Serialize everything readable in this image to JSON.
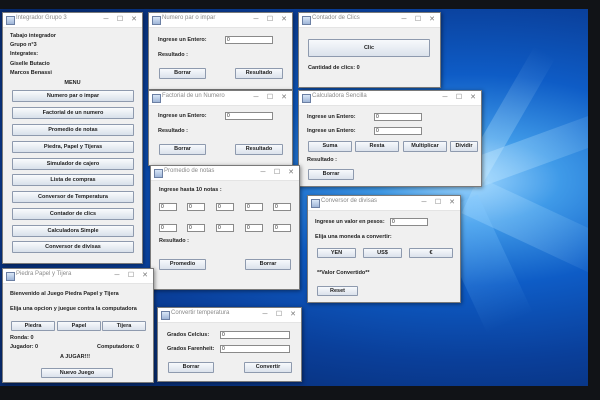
{
  "desktop": {
    "accent": "#0e5cc6"
  },
  "windows": {
    "grupo3": {
      "title": "Integrador Grupo 3",
      "info": [
        "Tabajo integrador",
        "Grupo n°3",
        "Integrates:",
        "Giselle Butacio",
        "Marcos Benassi"
      ],
      "menu_label": "MENU",
      "menu_items": [
        "Numero par o impar",
        "Factorial de un numero",
        "Promedio de notas",
        "Piedra, Papel y Tijeras",
        "Simulador de cajero",
        "Lista de compras",
        "Conversor de Temperatura",
        "Contador de clics",
        "Calculadora Simple",
        "Conversor de divisas"
      ]
    },
    "parimpar": {
      "title": "Numero par o impar",
      "prompt": "Ingrese un Entero:",
      "value": "0",
      "result_label": "Resultado :",
      "clear_label": "Borrar",
      "result_button": "Resultado"
    },
    "clics": {
      "title": "Contador de Clics",
      "button": "Clic",
      "count_label": "Cantidad de clics: 0"
    },
    "factorial": {
      "title": "Factorial de un Numero",
      "prompt": "Ingrese un Entero:",
      "value": "0",
      "result_label": "Resultado :",
      "clear_label": "Borrar",
      "result_button": "Resultado"
    },
    "calc": {
      "title": "Calculadora Sencilla",
      "prompt1": "Ingrese un Entero:",
      "value1": "0",
      "prompt2": "Ingrese un Entero:",
      "value2": "0",
      "ops": [
        "Suma",
        "Resta",
        "Multiplicar",
        "Dividir"
      ],
      "result_label": "Resultado :",
      "clear_label": "Borrar"
    },
    "promedio": {
      "title": "Promedio de notas",
      "prompt": "Ingrese hasta 10 notas :",
      "grades": [
        "0",
        "0",
        "0",
        "0",
        "0",
        "0",
        "0",
        "0",
        "0",
        "0"
      ],
      "result_label": "Resultado :",
      "avg_button": "Promedio",
      "clear_label": "Borrar"
    },
    "divisas": {
      "title": "Conversor de divisas",
      "prompt": "Ingrese un valor en pesos:",
      "value": "0",
      "choose_label": "Elija una moneda a convertir:",
      "currencies": [
        "YEN",
        "US$",
        "€"
      ],
      "converted_label": "**Valor Convertido**",
      "reset_label": "Reset"
    },
    "ppt": {
      "title": "Piedra Papel y Tijera",
      "welcome": "Bienvenido al Juego Piedra Papel y Tijera",
      "instruction": "Elija una opcion y juegue contra la computadora",
      "options": [
        "Piedra",
        "Papel",
        "Tijera"
      ],
      "round_label": "Ronda: 0",
      "player_label": "Jugador: 0",
      "computer_label": "Computadora: 0",
      "play_label": "A JUGAR!!!",
      "new_game": "Nuevo Juego"
    },
    "temp": {
      "title": "Convertir temperatura",
      "celsius_label": "Grados Celcius:",
      "celsius_value": "0",
      "fahrenheit_label": "Grados Farenheit:",
      "fahrenheit_value": "0",
      "clear_label": "Borrar",
      "convert_label": "Convertir"
    }
  }
}
